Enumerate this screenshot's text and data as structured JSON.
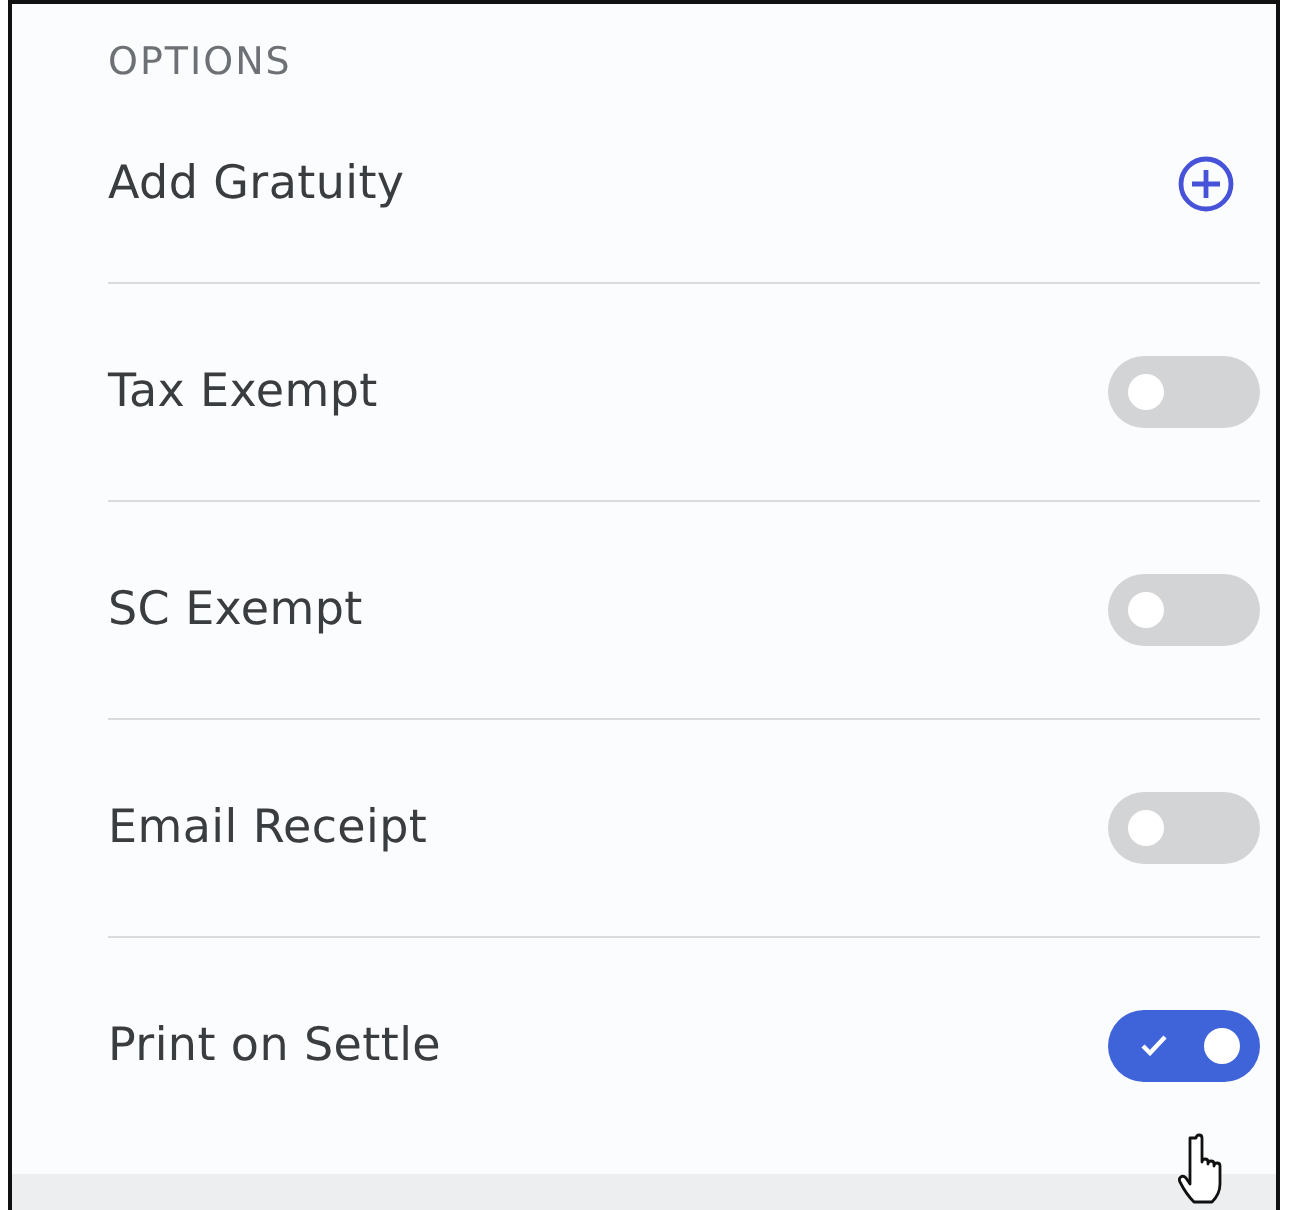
{
  "section_title": "OPTIONS",
  "options": [
    {
      "label": "Add Gratuity",
      "kind": "add"
    },
    {
      "label": "Tax Exempt",
      "kind": "toggle",
      "on": false
    },
    {
      "label": "SC Exempt",
      "kind": "toggle",
      "on": false
    },
    {
      "label": "Email Receipt",
      "kind": "toggle",
      "on": false
    },
    {
      "label": "Print on Settle",
      "kind": "toggle",
      "on": true
    }
  ]
}
